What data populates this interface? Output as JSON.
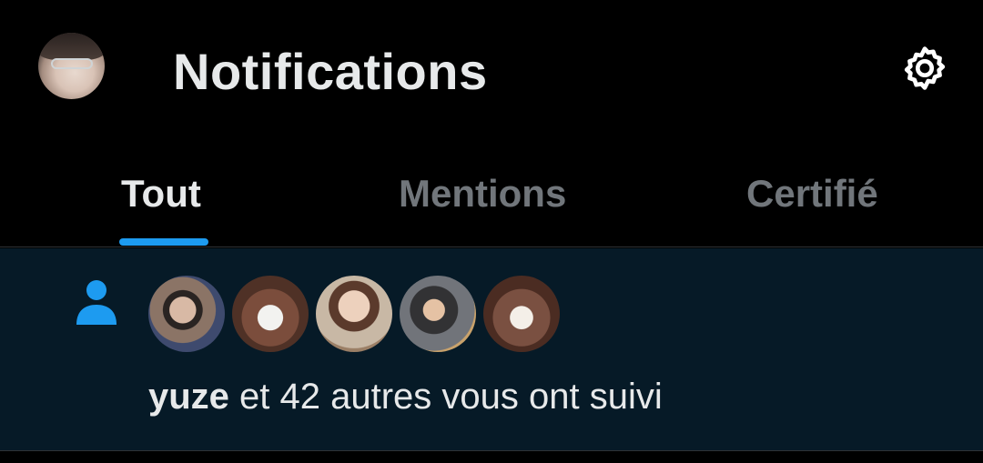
{
  "header": {
    "title": "Notifications",
    "profile_avatar": "user-avatar",
    "settings_icon": "gear-icon"
  },
  "tabs": [
    {
      "label": "Tout",
      "active": true
    },
    {
      "label": "Mentions",
      "active": false
    },
    {
      "label": "Certifié",
      "active": false
    }
  ],
  "notification": {
    "icon": "person-icon",
    "avatars": [
      "avatar-1",
      "avatar-2",
      "avatar-3",
      "avatar-4",
      "avatar-5"
    ],
    "username": "yuze",
    "text": " et 42 autres vous ont suivi"
  },
  "colors": {
    "background": "#000000",
    "notification_background": "#061a27",
    "accent": "#1d9bf0",
    "text_primary": "#e7e9ea",
    "text_secondary": "#71767b"
  }
}
